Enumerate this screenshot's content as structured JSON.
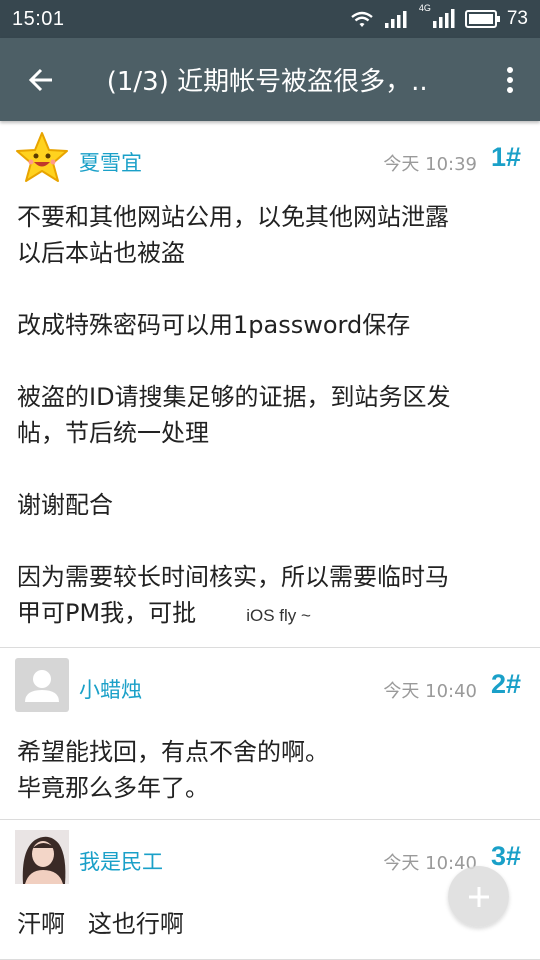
{
  "statusbar": {
    "time": "15:01",
    "battery": "73",
    "network_label": "4G",
    "icons": [
      "wifi-icon",
      "signal-icon",
      "signal-4g-icon",
      "battery-icon"
    ]
  },
  "appbar": {
    "title": "(1/3) 近期帐号被盗很多，..",
    "back_icon": "arrow-left-icon",
    "menu_icon": "more-vertical-icon"
  },
  "posts": [
    {
      "username": "夏雪宜",
      "time": "今天 10:39",
      "floor": "1#",
      "avatar": "star-avatar",
      "lines": [
        "不要和其他网站公用，以免其他网站泄露",
        "以后本站也被盗",
        "",
        "改成特殊密码可以用1password保存",
        "",
        "被盗的ID请搜集足够的证据，到站务区发",
        "帖，节后统一处理",
        "",
        "谢谢配合",
        "",
        "因为需要较长时间核实，所以需要临时马",
        "甲可PM我，可批"
      ],
      "signature": "iOS fly ~"
    },
    {
      "username": "小蜡烛",
      "time": "今天 10:40",
      "floor": "2#",
      "avatar": "default-user-avatar",
      "lines": [
        "希望能找回，有点不舍的啊。",
        "毕竟那么多年了。"
      ]
    },
    {
      "username": "我是民工",
      "time": "今天 10:40",
      "floor": "3#",
      "avatar": "photo-avatar",
      "lines": [
        "汗啊   这也行啊"
      ]
    }
  ],
  "fab_icon": "plus-icon",
  "colors": {
    "statusbar": "#37474f",
    "appbar": "#4d5f66",
    "accent": "#1aa0c8"
  }
}
